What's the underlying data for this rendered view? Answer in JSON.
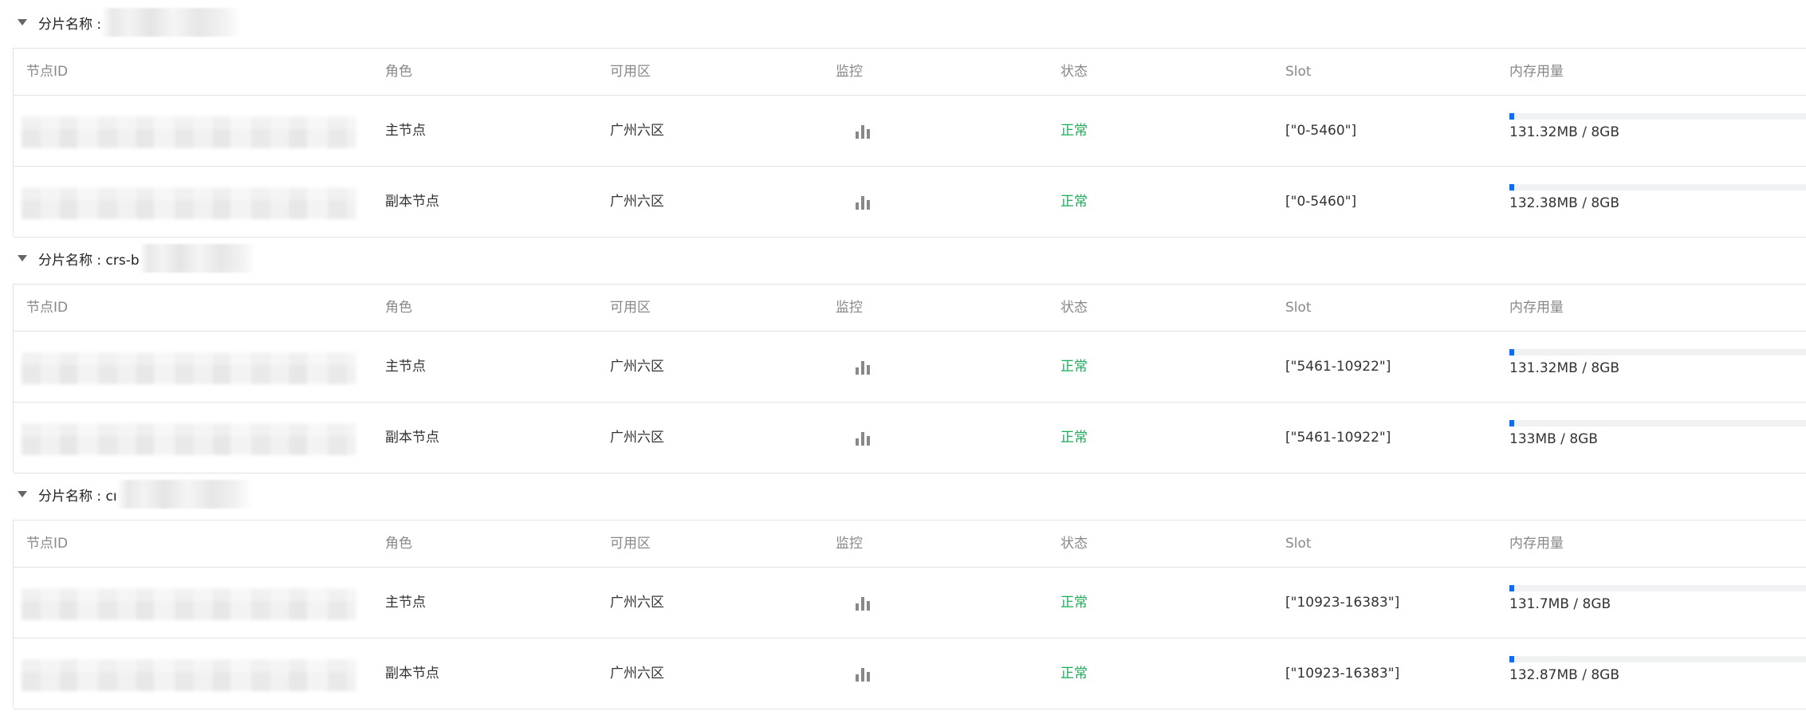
{
  "columns": {
    "node_id": "节点ID",
    "role": "角色",
    "zone": "可用区",
    "monitor": "监控",
    "status": "状态",
    "slot": "Slot",
    "memory": "内存用量"
  },
  "shards": [
    {
      "label": "分片名称 : ",
      "rows": [
        {
          "role": "主节点",
          "zone": "广州六区",
          "status": "正常",
          "slot": "[\"0-5460\"]",
          "memory_text": "131.32MB / 8GB",
          "memory_fraction": 0.016
        },
        {
          "role": "副本节点",
          "zone": "广州六区",
          "status": "正常",
          "slot": "[\"0-5460\"]",
          "memory_text": "132.38MB / 8GB",
          "memory_fraction": 0.016
        }
      ]
    },
    {
      "label": "分片名称 : crs-b",
      "rows": [
        {
          "role": "主节点",
          "zone": "广州六区",
          "status": "正常",
          "slot": "[\"5461-10922\"]",
          "memory_text": "131.32MB / 8GB",
          "memory_fraction": 0.016
        },
        {
          "role": "副本节点",
          "zone": "广州六区",
          "status": "正常",
          "slot": "[\"5461-10922\"]",
          "memory_text": "133MB / 8GB",
          "memory_fraction": 0.016
        }
      ]
    },
    {
      "label": "分片名称 : cı",
      "rows": [
        {
          "role": "主节点",
          "zone": "广州六区",
          "status": "正常",
          "slot": "[\"10923-16383\"]",
          "memory_text": "131.7MB / 8GB",
          "memory_fraction": 0.016
        },
        {
          "role": "副本节点",
          "zone": "广州六区",
          "status": "正常",
          "slot": "[\"10923-16383\"]",
          "memory_text": "132.87MB / 8GB",
          "memory_fraction": 0.016
        }
      ]
    }
  ],
  "icons": {
    "collapse": "caret-down-icon",
    "monitor": "bar-chart-icon"
  },
  "colors": {
    "status_ok": "#1aad59",
    "memory_fill": "#0a6cff",
    "memory_track": "#f0f1f3",
    "monitor_icon": "#888888"
  }
}
